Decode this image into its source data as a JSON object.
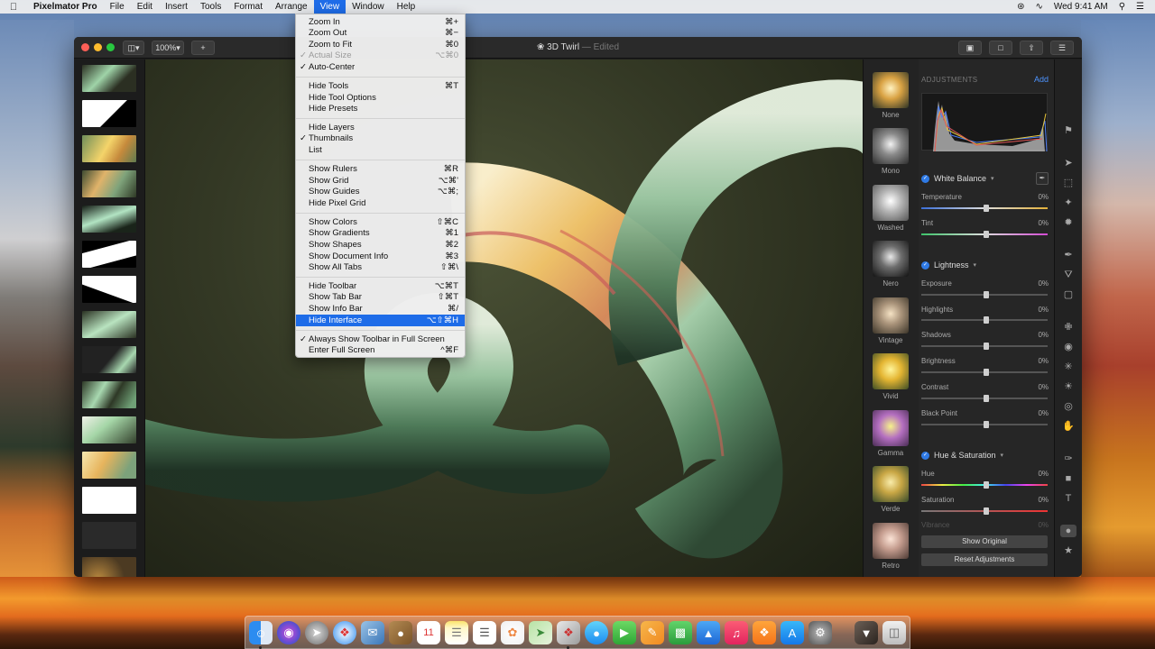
{
  "menubar": {
    "app_name": "Pixelmator Pro",
    "menus": [
      "File",
      "Edit",
      "Insert",
      "Tools",
      "Format",
      "Arrange",
      "View",
      "Window",
      "Help"
    ],
    "active_menu": "View",
    "clock": "Wed 9:41 AM"
  },
  "window": {
    "title": "3D Twirl",
    "edited": "— Edited",
    "zoom": "100%"
  },
  "view_menu": {
    "groups": [
      [
        {
          "label": "Zoom In",
          "shortcut": "⌘+"
        },
        {
          "label": "Zoom Out",
          "shortcut": "⌘−"
        },
        {
          "label": "Zoom to Fit",
          "shortcut": "⌘0"
        },
        {
          "label": "Actual Size",
          "shortcut": "⌥⌘0",
          "disabled": true
        },
        {
          "label": "Auto-Center",
          "shortcut": "",
          "checked": true
        }
      ],
      [
        {
          "label": "Hide Tools",
          "shortcut": "⌘T"
        },
        {
          "label": "Hide Tool Options",
          "shortcut": ""
        },
        {
          "label": "Hide Presets",
          "shortcut": ""
        }
      ],
      [
        {
          "label": "Hide Layers",
          "shortcut": ""
        },
        {
          "label": "Thumbnails",
          "shortcut": "",
          "checked": true
        },
        {
          "label": "List",
          "shortcut": ""
        }
      ],
      [
        {
          "label": "Show Rulers",
          "shortcut": "⌘R"
        },
        {
          "label": "Show Grid",
          "shortcut": "⌥⌘'"
        },
        {
          "label": "Show Guides",
          "shortcut": "⌥⌘;"
        },
        {
          "label": "Hide Pixel Grid",
          "shortcut": ""
        }
      ],
      [
        {
          "label": "Show Colors",
          "shortcut": "⇧⌘C"
        },
        {
          "label": "Show Gradients",
          "shortcut": "⌘1"
        },
        {
          "label": "Show Shapes",
          "shortcut": "⌘2"
        },
        {
          "label": "Show Document Info",
          "shortcut": "⌘3"
        },
        {
          "label": "Show All Tabs",
          "shortcut": "⇧⌘\\"
        }
      ],
      [
        {
          "label": "Hide Toolbar",
          "shortcut": "⌥⌘T"
        },
        {
          "label": "Show Tab Bar",
          "shortcut": "⇧⌘T"
        },
        {
          "label": "Show Info Bar",
          "shortcut": "⌘/"
        },
        {
          "label": "Hide Interface",
          "shortcut": "⌥⇧⌘H",
          "highlighted": true
        }
      ],
      [
        {
          "label": "Always Show Toolbar in Full Screen",
          "shortcut": "",
          "checked": true
        },
        {
          "label": "Enter Full Screen",
          "shortcut": "^⌘F"
        }
      ]
    ]
  },
  "presets": [
    "None",
    "Mono",
    "Washed",
    "Nero",
    "Vintage",
    "Vivid",
    "Gamma",
    "Verde",
    "Retro"
  ],
  "adjustments": {
    "header": "ADJUSTMENTS",
    "add": "Add",
    "sections": [
      {
        "title": "White Balance",
        "sliders": [
          {
            "label": "Temperature",
            "value": "0%"
          },
          {
            "label": "Tint",
            "value": "0%"
          }
        ]
      },
      {
        "title": "Lightness",
        "sliders": [
          {
            "label": "Exposure",
            "value": "0%"
          },
          {
            "label": "Highlights",
            "value": "0%"
          },
          {
            "label": "Shadows",
            "value": "0%"
          },
          {
            "label": "Brightness",
            "value": "0%"
          },
          {
            "label": "Contrast",
            "value": "0%"
          },
          {
            "label": "Black Point",
            "value": "0%"
          }
        ]
      },
      {
        "title": "Hue & Saturation",
        "sliders": [
          {
            "label": "Hue",
            "value": "0%"
          },
          {
            "label": "Saturation",
            "value": "0%"
          },
          {
            "label": "Vibrance",
            "value": "0%"
          }
        ]
      }
    ],
    "show_original": "Show Original",
    "reset": "Reset Adjustments"
  },
  "colors": {
    "accent": "#1e6ce8",
    "link": "#4d94ff"
  }
}
